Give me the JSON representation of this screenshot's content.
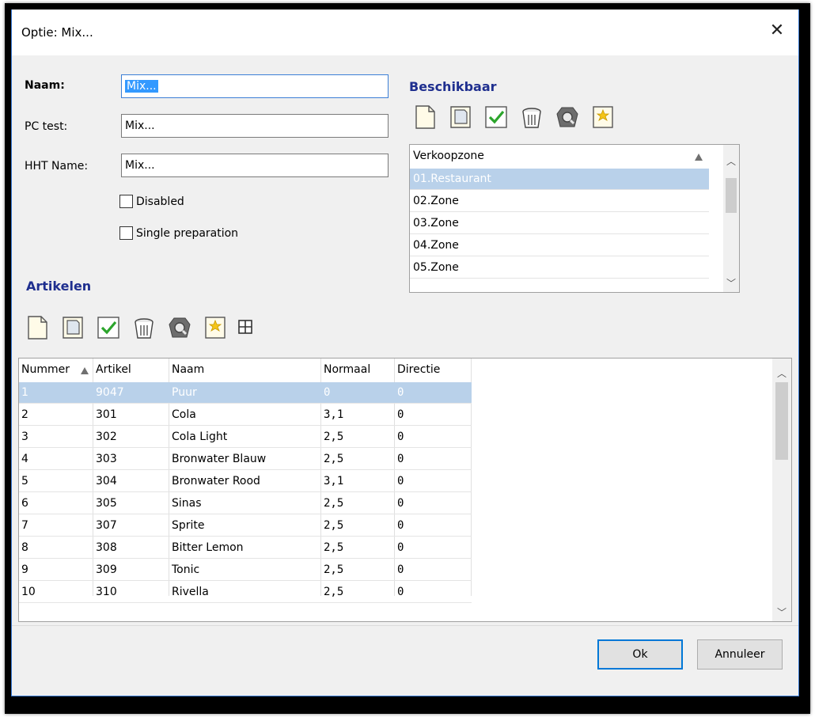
{
  "window": {
    "title": "Optie: Mix...",
    "close_symbol": "✕"
  },
  "form": {
    "naam_label": "Naam:",
    "naam_value": "Mix...",
    "pc_test_label": "PC test:",
    "pc_test_value": "Mix...",
    "hht_label": "HHT Name:",
    "hht_value": "Mix...",
    "disabled_label": "Disabled",
    "single_label": "Single preparation"
  },
  "beschikbaar": {
    "title": "Beschikbaar",
    "icons": [
      "new-icon",
      "edit-icon",
      "check-icon",
      "delete-bin-icon",
      "search-icon",
      "favorite-icon"
    ],
    "column": "Verkoopzone",
    "rows": [
      "01.Restaurant",
      "02.Zone",
      "03.Zone",
      "04.Zone",
      "05.Zone"
    ],
    "selected_index": 0
  },
  "artikelen": {
    "title": "Artikelen",
    "icons": [
      "new-icon",
      "edit-icon",
      "check-icon",
      "delete-bin-icon",
      "search-icon",
      "favorite-icon",
      "grid-icon"
    ],
    "columns": [
      "Nummer",
      "Artikel",
      "Naam",
      "Normaal",
      "Directie"
    ],
    "rows": [
      [
        "1",
        "9047",
        "Puur",
        "0",
        "0"
      ],
      [
        "2",
        "301",
        "Cola",
        "3,1",
        "0"
      ],
      [
        "3",
        "302",
        "Cola Light",
        "2,5",
        "0"
      ],
      [
        "4",
        "303",
        "Bronwater Blauw",
        "2,5",
        "0"
      ],
      [
        "5",
        "304",
        "Bronwater Rood",
        "3,1",
        "0"
      ],
      [
        "6",
        "305",
        "Sinas",
        "2,5",
        "0"
      ],
      [
        "7",
        "307",
        "Sprite",
        "2,5",
        "0"
      ],
      [
        "8",
        "308",
        "Bitter Lemon",
        "2,5",
        "0"
      ],
      [
        "9",
        "309",
        "Tonic",
        "2,5",
        "0"
      ],
      [
        "10",
        "310",
        "Rivella",
        "2,5",
        "0"
      ]
    ],
    "selected_index": 0
  },
  "buttons": {
    "ok": "Ok",
    "cancel": "Annuleer"
  },
  "colors": {
    "section_title": "#1f2f8f",
    "selection": "#b9d1ea",
    "default_button_border": "#0078d7"
  }
}
